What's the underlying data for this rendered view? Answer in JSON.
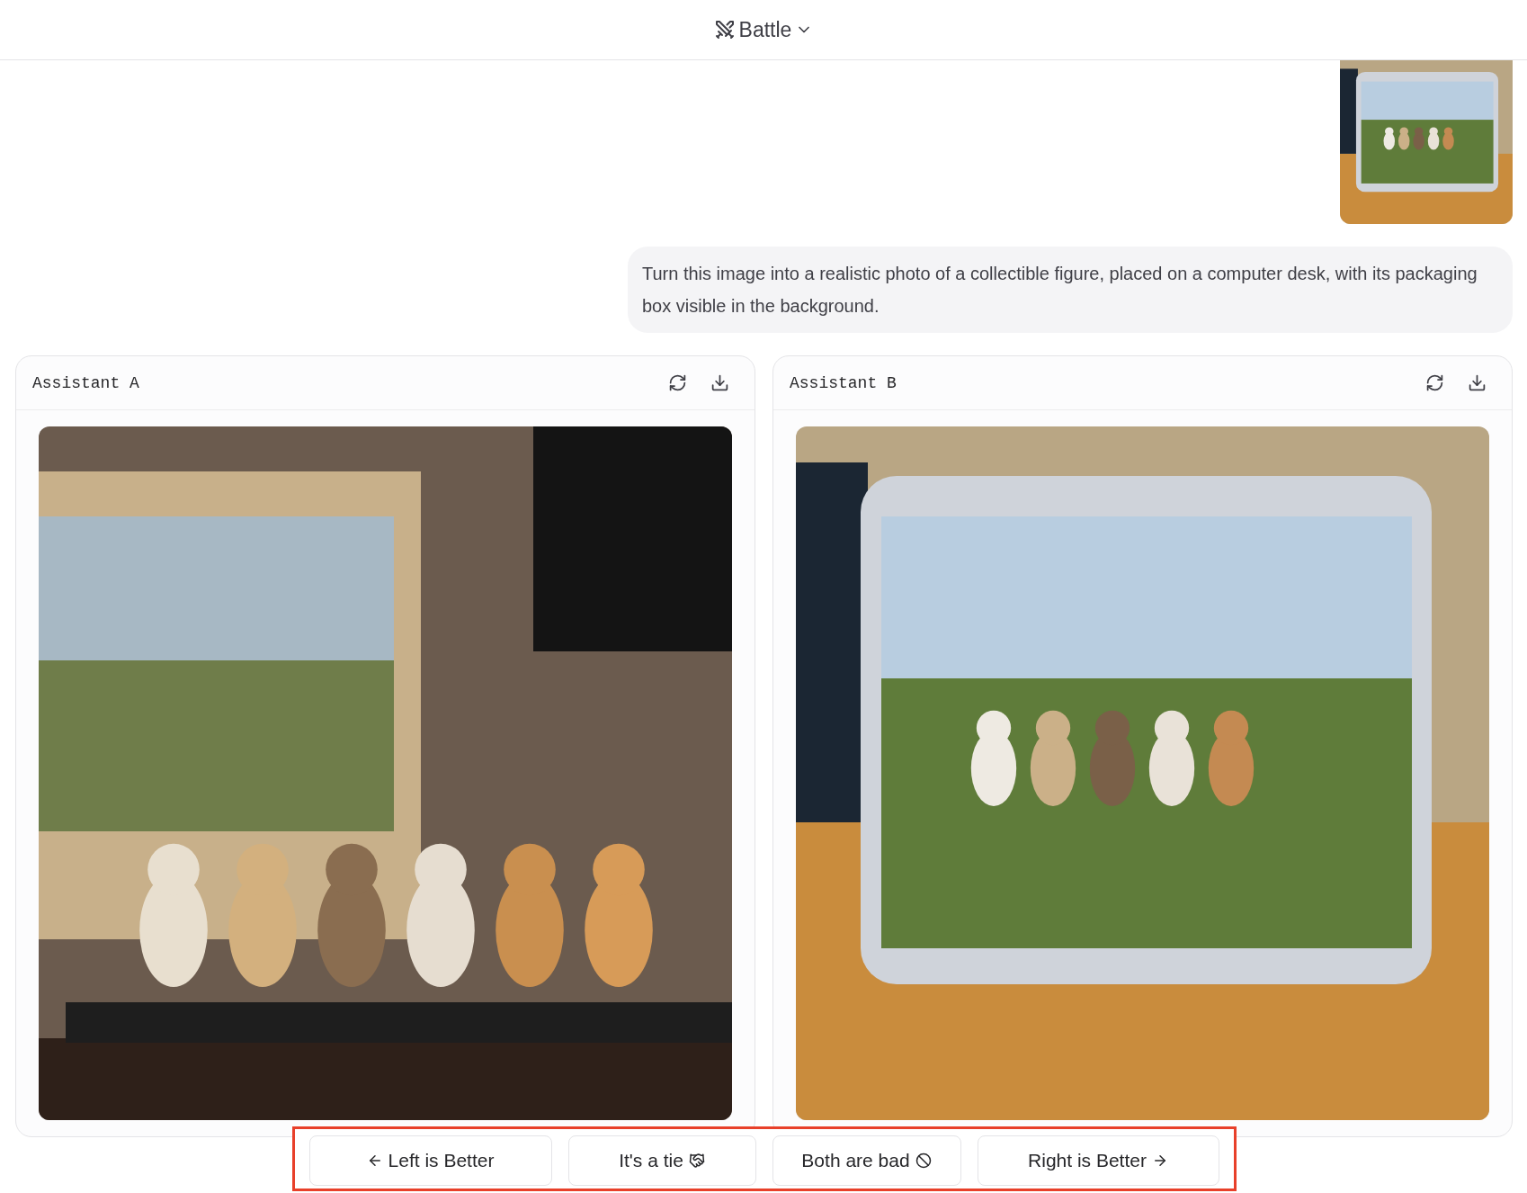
{
  "header": {
    "title": "Battle"
  },
  "prompt": "Turn this image into a realistic photo of a collectible figure, placed on a computer desk, with its packaging box visible in the background.",
  "panels": [
    {
      "label": "Assistant A"
    },
    {
      "label": "Assistant B"
    }
  ],
  "votes": [
    {
      "kind": "left",
      "label": "Left is Better"
    },
    {
      "kind": "tie",
      "label": "It's a tie"
    },
    {
      "kind": "bad",
      "label": "Both are bad"
    },
    {
      "kind": "right",
      "label": "Right is Better"
    }
  ]
}
